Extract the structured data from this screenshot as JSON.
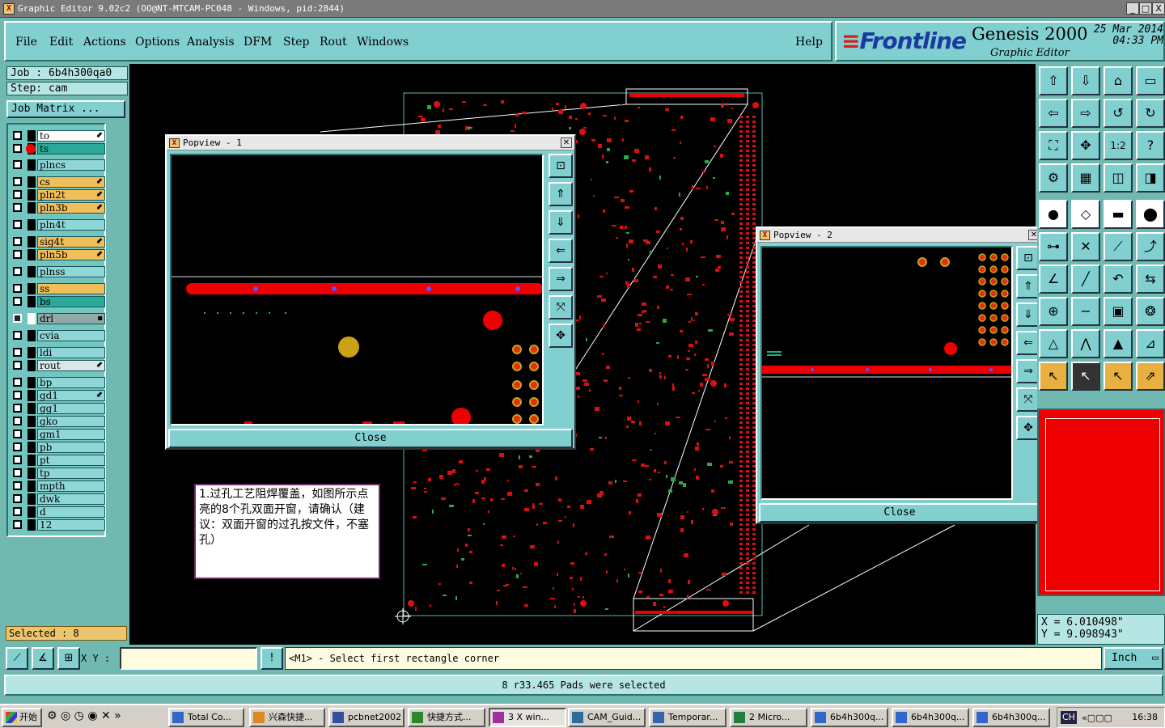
{
  "window": {
    "title": "Graphic Editor 9.02c2 (OO@NT-MTCAM-PC048 - Windows, pid:2844)",
    "minimize": "_",
    "maximize": "□",
    "close": "X"
  },
  "menu": {
    "items": [
      "File",
      "Edit",
      "Actions",
      "Options",
      "Analysis",
      "DFM",
      "Step",
      "Rout",
      "Windows"
    ],
    "help": "Help"
  },
  "brand": {
    "logo": "Frontline",
    "product": "Genesis 2000",
    "subtitle": "Graphic Editor",
    "date": "25 Mar 2014",
    "time": "04:33 PM"
  },
  "job": {
    "job_label": "Job  :  6b4h300qa0",
    "step_label": "Step:  cam",
    "matrix_button": "Job Matrix ..."
  },
  "layers": [
    {
      "name": "to",
      "color": "#ffffff",
      "arrow": "⬋"
    },
    {
      "name": "ts",
      "color": "#2aa89a",
      "dot": true
    },
    {
      "name": "plncs",
      "color": "#8fd6d8"
    },
    {
      "name": "cs",
      "color": "#f2be5a",
      "arrow": "⬋"
    },
    {
      "name": "pln2t",
      "color": "#f2be5a",
      "arrow": "⬋"
    },
    {
      "name": "pln3b",
      "color": "#f2be5a",
      "arrow": "⬋"
    },
    {
      "name": "pln4t",
      "color": "#8fd6d8"
    },
    {
      "name": "sig4t",
      "color": "#f2be5a",
      "arrow": "⬋"
    },
    {
      "name": "pln5b",
      "color": "#f2be5a",
      "arrow": "⬋"
    },
    {
      "name": "plnss",
      "color": "#8fd6d8"
    },
    {
      "name": "ss",
      "color": "#f2be5a"
    },
    {
      "name": "bs",
      "color": "#2aa89a"
    },
    {
      "name": "drl",
      "color": "#8fa8a8",
      "arrow": "▪"
    },
    {
      "name": "cvia",
      "color": "#8fd6d8"
    },
    {
      "name": "ldi",
      "color": "#8fd6d8"
    },
    {
      "name": "rout",
      "color": "#d8e8e8",
      "arrow": "⬋"
    },
    {
      "name": "bp",
      "color": "#8fd6d8"
    },
    {
      "name": "gd1",
      "color": "#8fd6d8",
      "arrow": "⬋"
    },
    {
      "name": "gg1",
      "color": "#8fd6d8"
    },
    {
      "name": "gko",
      "color": "#8fd6d8"
    },
    {
      "name": "gm1",
      "color": "#8fd6d8"
    },
    {
      "name": "pb",
      "color": "#8fd6d8"
    },
    {
      "name": "pt",
      "color": "#8fd6d8"
    },
    {
      "name": "tp",
      "color": "#8fd6d8"
    },
    {
      "name": "mpth",
      "color": "#8fd6d8"
    },
    {
      "name": "dwk",
      "color": "#8fd6d8"
    },
    {
      "name": "d",
      "color": "#8fd6d8"
    },
    {
      "name": "12",
      "color": "#8fd6d8"
    }
  ],
  "selected": "Selected : 8",
  "popview1": {
    "title": "Popview - 1",
    "close": "Close"
  },
  "popview2": {
    "title": "Popview - 2",
    "close": "Close"
  },
  "note": "1.过孔工艺阻焊覆盖，如图所示点亮的8个孔双面开窗，请确认（建议：双面开窗的过孔按文件，不塞孔）",
  "coords": {
    "x": "X  =  6.010498\"",
    "y": "Y  =  9.098943\""
  },
  "input": {
    "xy_label": "X Y :",
    "value": "",
    "excl": "!"
  },
  "prompt": "<M1> - Select first rectangle corner",
  "unit": "Inch",
  "status": "8 r33.465 Pads were selected",
  "taskbar": {
    "start": "开始",
    "items": [
      "Total Co...",
      "兴森快捷...",
      "pcbnet2002",
      "快捷方式...",
      "3 X win...",
      "CAM_Guid...",
      "Temporar...",
      "2 Micro...",
      "6b4h300q...",
      "6b4h300q...",
      "6b4h300q..."
    ],
    "clock": "16:38",
    "lang": "CH"
  }
}
